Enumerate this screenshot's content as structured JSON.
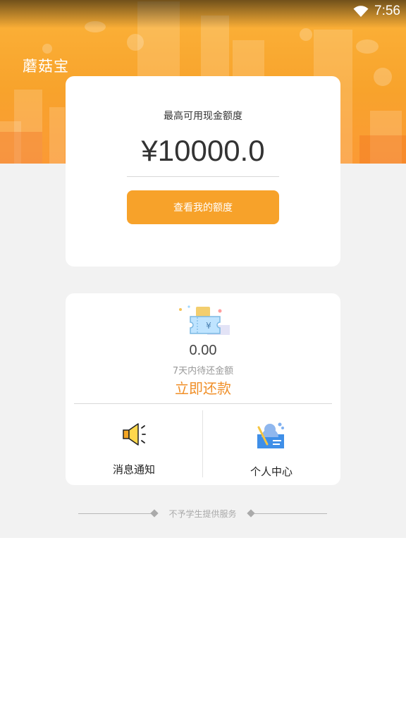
{
  "status_bar": {
    "time": "7:56"
  },
  "header": {
    "app_title": "蘑菇宝"
  },
  "quota_card": {
    "label": "最高可用现金额度",
    "amount": "¥10000.0",
    "button_label": "查看我的额度"
  },
  "repay_card": {
    "amount": "0.00",
    "subtitle": "7天内待还金额",
    "action_label": "立即还款"
  },
  "menu": {
    "notifications_label": "消息通知",
    "profile_label": "个人中心"
  },
  "footer": {
    "note": "不予学生提供服务"
  },
  "colors": {
    "accent": "#f7a22a",
    "action_text": "#f08f28",
    "background_gray": "#f2f2f2"
  },
  "icons": [
    "wifi-icon",
    "ticket-yen-icon",
    "speaker-icon",
    "user-card-icon"
  ]
}
